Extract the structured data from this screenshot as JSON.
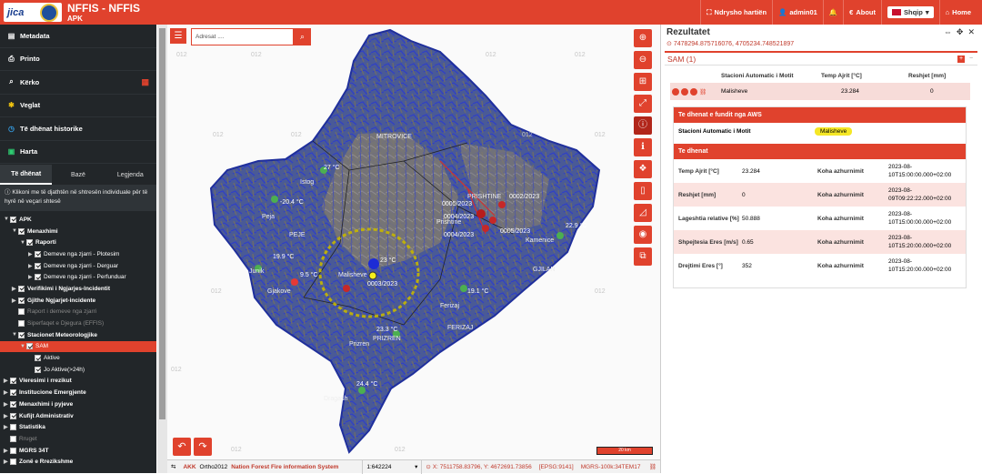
{
  "header": {
    "title": "NFFIS - NFFIS",
    "subtitle": "APK",
    "logo_text": "jica",
    "nav": [
      {
        "label": "Ndrysho hartiën",
        "icon": "sitemap-icon"
      },
      {
        "label": "admin01",
        "icon": "user-icon"
      },
      {
        "label": "",
        "icon": "bell-icon"
      },
      {
        "label": "About",
        "icon": "euro-icon"
      },
      {
        "label": "Shqip",
        "icon": "flag-icon"
      },
      {
        "label": "Home",
        "icon": "home-icon"
      }
    ]
  },
  "sidebar": {
    "menu": [
      {
        "label": "Metadata",
        "icon": "file-icon"
      },
      {
        "label": "Printo",
        "icon": "print-icon"
      },
      {
        "label": "Kërko",
        "icon": "search-icon"
      },
      {
        "label": "Veglat",
        "icon": "tools-icon"
      },
      {
        "label": "Të dhënat historike",
        "icon": "clock-icon"
      },
      {
        "label": "Harta",
        "icon": "map-icon"
      }
    ],
    "tabs": [
      "Të dhënat",
      "Bazë",
      "Legjenda"
    ],
    "info": "Klikoni me të djathtën në shtresën individuale për të hyrë në veçari shtesë",
    "tree": [
      {
        "label": "APK",
        "level": 0,
        "toggle": "▼",
        "checked": true,
        "bold": true
      },
      {
        "label": "Menaxhimi",
        "level": 1,
        "toggle": "▼",
        "checked": true,
        "bold": true
      },
      {
        "label": "Raporti",
        "level": 2,
        "toggle": "▼",
        "checked": true,
        "bold": true
      },
      {
        "label": "Demeve nga zjarri - Plotesim",
        "level": 3,
        "toggle": "▶",
        "checked": true
      },
      {
        "label": "Demeve nga zjarri - Derguar",
        "level": 3,
        "toggle": "▶",
        "checked": true
      },
      {
        "label": "Demeve nga zjarri - Perfunduar",
        "level": 3,
        "toggle": "▶",
        "checked": true
      },
      {
        "label": "Verifikimi i Ngjarjes-Incidentit",
        "level": 1,
        "toggle": "▶",
        "checked": true,
        "bold": true
      },
      {
        "label": "Gjithe Ngjarjet-incidente",
        "level": 1,
        "toggle": "▶",
        "checked": true,
        "bold": true
      },
      {
        "label": "Raport i demeve nga zjarri",
        "level": 1,
        "toggle": "",
        "checked": false,
        "dim": true
      },
      {
        "label": "Siperfaqet e Djegura (EFFIS)",
        "level": 1,
        "toggle": "",
        "checked": false,
        "dim": true
      },
      {
        "label": "Stacionet Meteorologjike",
        "level": 1,
        "toggle": "▼",
        "checked": true,
        "bold": true
      },
      {
        "label": "SAM",
        "level": 2,
        "toggle": "▼",
        "checked": true,
        "selected": true
      },
      {
        "label": "Aktive",
        "level": 3,
        "toggle": "",
        "checked": true
      },
      {
        "label": "Jo Aktive(>24h)",
        "level": 3,
        "toggle": "",
        "checked": true
      },
      {
        "label": "Vleresimi i rrezikut",
        "level": 0,
        "toggle": "▶",
        "checked": true,
        "bold": true
      },
      {
        "label": "Institucione Emergjente",
        "level": 0,
        "toggle": "▶",
        "checked": true,
        "bold": true
      },
      {
        "label": "Menaxhimi i pyjeve",
        "level": 0,
        "toggle": "▶",
        "checked": true,
        "bold": true
      },
      {
        "label": "Kufijt Administrativ",
        "level": 0,
        "toggle": "▶",
        "checked": true,
        "bold": true
      },
      {
        "label": "Statistika",
        "level": 0,
        "toggle": "▶",
        "checked": false,
        "bold": true
      },
      {
        "label": "Rruget",
        "level": 0,
        "toggle": "",
        "checked": false,
        "dim": true
      },
      {
        "label": "MGRS 34T",
        "level": 0,
        "toggle": "▶",
        "checked": false,
        "bold": true
      },
      {
        "label": "Zonë e Rrezikshme",
        "level": 0,
        "toggle": "▶",
        "checked": false,
        "bold": true
      }
    ]
  },
  "map": {
    "search_placeholder": "Adresat ....",
    "grid_label": "012",
    "scale_text": "20 km",
    "places": [
      {
        "name": "MITROVICE"
      },
      {
        "name": "PRISHTINE"
      },
      {
        "name": "Prishtine"
      },
      {
        "name": "Kamenice"
      },
      {
        "name": "GJILAN"
      },
      {
        "name": "FERIZAJ"
      },
      {
        "name": "Ferizaj"
      },
      {
        "name": "PEJE"
      },
      {
        "name": "Peja"
      },
      {
        "name": "Junik"
      },
      {
        "name": "Gjakove"
      },
      {
        "name": "Malisheve"
      },
      {
        "name": "PRIZREN"
      },
      {
        "name": "Prizren"
      },
      {
        "name": "Dragash"
      },
      {
        "name": "Istog"
      }
    ],
    "temps": [
      {
        "text": "27 °C"
      },
      {
        "text": "-20.4 °C"
      },
      {
        "text": "19.9 °C"
      },
      {
        "text": "9.5 °C"
      },
      {
        "text": "23 °C"
      },
      {
        "text": "23.3 °C"
      },
      {
        "text": "19.1 °C"
      },
      {
        "text": "22.9 °C"
      },
      {
        "text": "24.4 °C"
      }
    ],
    "dates": [
      {
        "text": "0005/2023"
      },
      {
        "text": "0002/2023"
      },
      {
        "text": "0004/2023"
      },
      {
        "text": "0005/2023"
      },
      {
        "text": "0004/2023"
      },
      {
        "text": "0003/2023"
      }
    ]
  },
  "statusbar": {
    "brand": "AKK",
    "basemap": "Ortho2012",
    "system": "Nation Forest Fire information System",
    "scale": "1:642224",
    "coords": "X: 7511758.83796, Y: 4672691.73856",
    "epsg": "[EPSG:9141]",
    "mgrs": "MGRS-100k:34TEM17"
  },
  "panel": {
    "title": "Rezultatet",
    "coord": "7478294.875716076, 4705234.748521897",
    "group_label": "SAM (1)",
    "columns": [
      "Stacioni Automatic i Motit",
      "Temp Ajrit [°C]",
      "Reshjet [mm]"
    ],
    "row": {
      "station": "Malisheve",
      "temp": "23.284",
      "rain": "0"
    },
    "aws_title": "Te dhenat e fundit nga AWS",
    "aws_station_label": "Stacioni Automatic i Motit",
    "aws_station_value": "Malisheve",
    "te_dhenat_title": "Te dhenat",
    "measurements": [
      {
        "label": "Temp Ajrit [°C]",
        "value": "23.284",
        "update_label": "Koha azhurnimit",
        "time": "2023-08-10T15:00:00.000+02:00"
      },
      {
        "label": "Reshjet [mm]",
        "value": "0",
        "update_label": "Koha azhurnimit",
        "time": "2023-08-09T09:22:22.000+02:00"
      },
      {
        "label": "Lageshtia relative [%]",
        "value": "50.888",
        "update_label": "Koha azhurnimit",
        "time": "2023-08-10T15:00:00.000+02:00"
      },
      {
        "label": "Shpejtesia Eres [m/s]",
        "value": "0.65",
        "update_label": "Koha azhurnimit",
        "time": "2023-08-10T15:20:00.000+02:00"
      },
      {
        "label": "Drejtimi Eres [°]",
        "value": "352",
        "update_label": "Koha azhurnimit",
        "time": "2023-08-10T15:20:00.000+02:00"
      }
    ]
  },
  "colors": {
    "accent": "#e0422d",
    "sidebar": "#222629",
    "row_highlight": "#f7dcd9"
  }
}
